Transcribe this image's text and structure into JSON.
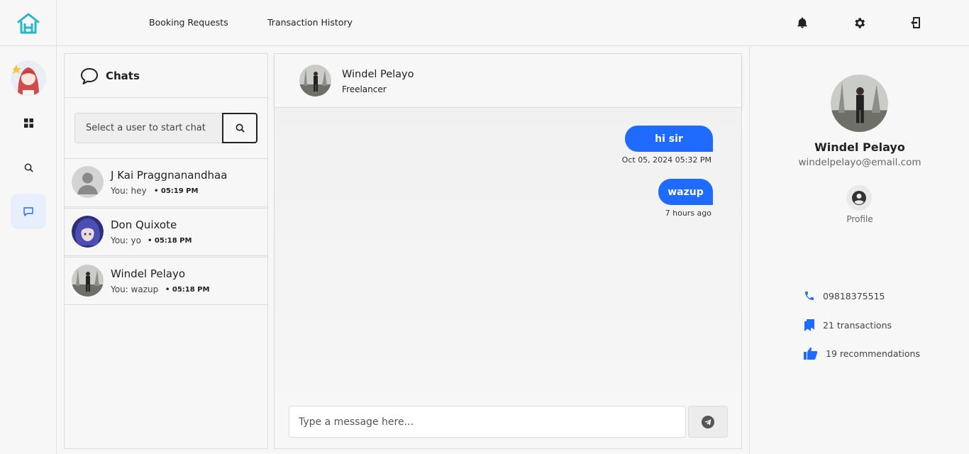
{
  "nav": {
    "links": [
      "Booking Requests",
      "Transaction History"
    ],
    "icons": [
      "bell-icon",
      "gear-icon",
      "logout-icon"
    ]
  },
  "sidebar": {
    "items": [
      "dashboard-grid-icon",
      "search-icon",
      "chat-icon"
    ],
    "active": "chat-icon"
  },
  "chats": {
    "title": "Chats",
    "search_placeholder": "Select a user to start chat",
    "list": [
      {
        "name": "J Kai Praggnanandhaa",
        "last": "You: hey",
        "time": "• 05:19 PM"
      },
      {
        "name": "Don Quixote",
        "last": "You: yo",
        "time": "• 05:18 PM"
      },
      {
        "name": "Windel Pelayo",
        "last": "You: wazup",
        "time": "• 05:18 PM"
      }
    ]
  },
  "conversation": {
    "name": "Windel Pelayo",
    "role": "Freelancer",
    "messages": [
      {
        "text": "hi sir",
        "time": "Oct 05, 2024 05:32 PM"
      },
      {
        "text": "wazup",
        "time": "7 hours ago"
      }
    ],
    "input_placeholder": "Type a message here..."
  },
  "profile": {
    "name": "Windel Pelayo",
    "email": "windelpelayo@email.com",
    "profile_label": "Profile",
    "phone": "09818375515",
    "transactions": "21 transactions",
    "recommendations": "19 recommendations"
  },
  "colors": {
    "accent": "#1f6bff",
    "logo": "#29b6c9",
    "active_bg": "#e8effc"
  }
}
